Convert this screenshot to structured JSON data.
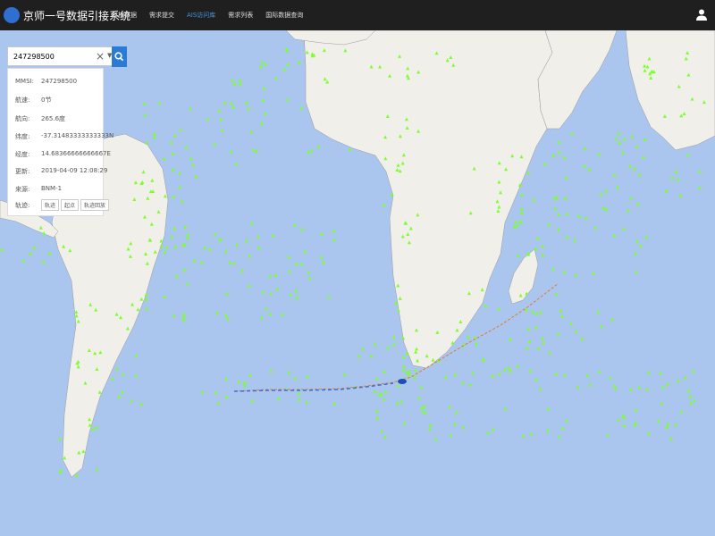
{
  "app": {
    "title": "京师一号数据引接系统"
  },
  "nav": {
    "items": [
      "存档数据",
      "需求提交",
      "AIS访问库",
      "需求列表",
      "国际数据查询"
    ],
    "active": 2
  },
  "search": {
    "value": "247298500"
  },
  "vessel": {
    "rows": [
      {
        "label": "MMSI:",
        "value": "247298500"
      },
      {
        "label": "航速:",
        "value": "0节"
      },
      {
        "label": "航向:",
        "value": "265.6度"
      },
      {
        "label": "纬度:",
        "value": "-37.31483333333333N"
      },
      {
        "label": "经度:",
        "value": "14.68366666666667E"
      },
      {
        "label": "更新:",
        "value": "2019-04-09 12:08:29"
      },
      {
        "label": "来源:",
        "value": "BNM-1"
      }
    ],
    "track_label": "轨迹:",
    "buttons": [
      "轨迹",
      "起点",
      "轨迹回放"
    ]
  },
  "colors": {
    "topbar": "#1f1f1f",
    "ocean": "#aac6ee",
    "land": "#f1efe9",
    "ship": "#7cff2e",
    "accent": "#2b7bd4",
    "route": "#e07a2c"
  },
  "icons": {
    "logo": "globe-logo-icon",
    "user": "user-icon",
    "search": "search-icon",
    "clear": "close-icon",
    "dropdown": "caret-down-icon"
  }
}
